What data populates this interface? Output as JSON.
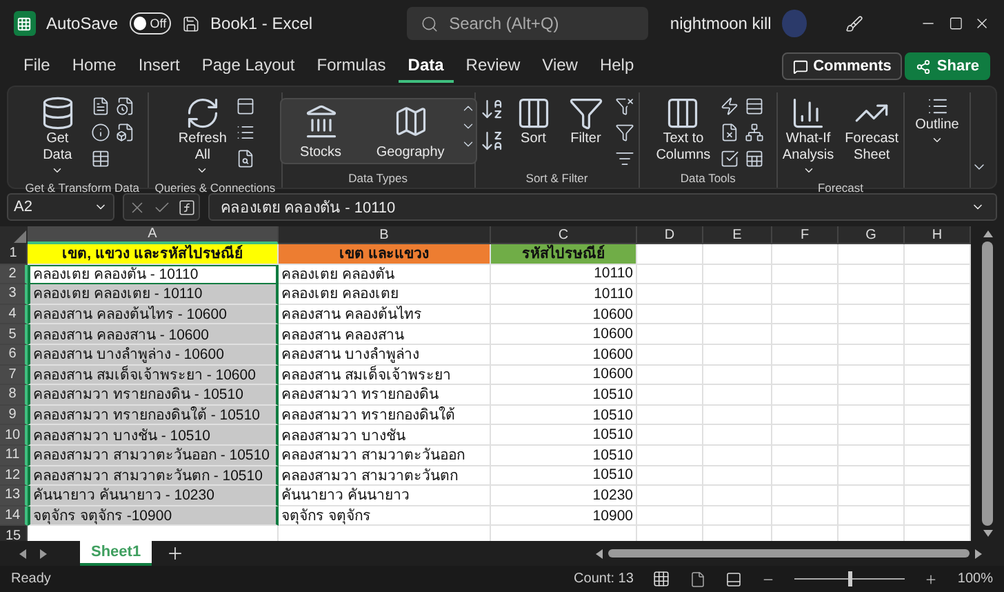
{
  "title_bar": {
    "autosave": {
      "label": "AutoSave",
      "on": false,
      "state_text": "Off"
    },
    "document": "Book1  -  Excel",
    "search": {
      "placeholder": "Search (Alt+Q)"
    },
    "user": "nightmoon kill"
  },
  "menu_tabs": [
    {
      "label": "File",
      "selected": false
    },
    {
      "label": "Home",
      "selected": false
    },
    {
      "label": "Insert",
      "selected": false
    },
    {
      "label": "Page Layout",
      "selected": false
    },
    {
      "label": "Formulas",
      "selected": false
    },
    {
      "label": "Data",
      "selected": true
    },
    {
      "label": "Review",
      "selected": false
    },
    {
      "label": "View",
      "selected": false
    },
    {
      "label": "Help",
      "selected": false
    }
  ],
  "comments_button": "Comments",
  "share_button": "Share",
  "ribbon": {
    "groups": [
      {
        "kind": "buttons",
        "label": "Get & Transform Data",
        "buttons": [
          {
            "label": "Get Data",
            "dropdown": true
          }
        ]
      },
      {
        "kind": "buttons",
        "label": "Queries & Connections",
        "buttons": [
          {
            "label": "Refresh All",
            "dropdown": true
          }
        ]
      },
      {
        "kind": "gallery",
        "label": "Data Types",
        "buttons": [
          {
            "label": "Stocks"
          },
          {
            "label": "Geography"
          }
        ]
      },
      {
        "kind": "buttons",
        "label": "Sort & Filter",
        "buttons": [
          {
            "label": "Sort",
            "dropdown": false
          },
          {
            "label": "Filter",
            "dropdown": false
          }
        ]
      },
      {
        "kind": "buttons",
        "label": "Data Tools",
        "buttons": [
          {
            "label": "Text to Columns",
            "dropdown": false
          }
        ]
      },
      {
        "kind": "buttons",
        "label": "Forecast",
        "buttons": [
          {
            "label": "What-If Analysis",
            "dropdown": true
          },
          {
            "label": "Forecast Sheet",
            "dropdown": false
          }
        ]
      },
      {
        "kind": "buttons",
        "buttons": [
          {
            "label": "Outline",
            "dropdown": true
          }
        ]
      }
    ]
  },
  "formula_bar": {
    "name_box": "A2",
    "formula": "คลองเตย คลองตัน - 10110"
  },
  "sheet": {
    "columns": [
      {
        "label": "A",
        "selected": true
      },
      {
        "label": "B",
        "selected": false
      },
      {
        "label": "C",
        "selected": false
      },
      {
        "label": "D",
        "selected": false
      },
      {
        "label": "E",
        "selected": false
      },
      {
        "label": "F",
        "selected": false
      },
      {
        "label": "G",
        "selected": false
      },
      {
        "label": "H",
        "selected": false
      }
    ],
    "header_row_number": "1",
    "header_row": [
      {
        "text": "เขต, แขวง และรหัสไปรษณีย์",
        "color": "#ffff00"
      },
      {
        "text": "เขต และแขวง",
        "color": "#ed7d31"
      },
      {
        "text": "รหัสไปรษณีย์",
        "color": "#70ad47"
      }
    ],
    "rows": [
      {
        "number": "2",
        "selected": true,
        "active": true,
        "cells": [
          "คลองเตย คลองตัน - 10110",
          "คลองเตย คลองตัน",
          "10110"
        ]
      },
      {
        "number": "3",
        "selected": true,
        "active": false,
        "cells": [
          "คลองเตย คลองเตย - 10110",
          "คลองเตย คลองเตย",
          "10110"
        ]
      },
      {
        "number": "4",
        "selected": true,
        "active": false,
        "cells": [
          "คลองสาน คลองต้นไทร - 10600",
          "คลองสาน คลองต้นไทร",
          "10600"
        ]
      },
      {
        "number": "5",
        "selected": true,
        "active": false,
        "cells": [
          "คลองสาน คลองสาน - 10600",
          "คลองสาน คลองสาน",
          "10600"
        ]
      },
      {
        "number": "6",
        "selected": true,
        "active": false,
        "cells": [
          "คลองสาน บางลำพูล่าง - 10600",
          "คลองสาน บางลำพูล่าง",
          "10600"
        ]
      },
      {
        "number": "7",
        "selected": true,
        "active": false,
        "cells": [
          "คลองสาน สมเด็จเจ้าพระยา - 10600",
          "คลองสาน สมเด็จเจ้าพระยา",
          "10600"
        ]
      },
      {
        "number": "8",
        "selected": true,
        "active": false,
        "cells": [
          "คลองสามวา ทรายกองดิน - 10510",
          "คลองสามวา ทรายกองดิน",
          "10510"
        ]
      },
      {
        "number": "9",
        "selected": true,
        "active": false,
        "cells": [
          "คลองสามวา ทรายกองดินใต้ - 10510",
          "คลองสามวา ทรายกองดินใต้",
          "10510"
        ]
      },
      {
        "number": "10",
        "selected": true,
        "active": false,
        "cells": [
          "คลองสามวา บางชัน - 10510",
          "คลองสามวา บางชัน",
          "10510"
        ]
      },
      {
        "number": "11",
        "selected": true,
        "active": false,
        "cells": [
          "คลองสามวา สามวาตะวันออก - 10510",
          "คลองสามวา สามวาตะวันออก",
          "10510"
        ]
      },
      {
        "number": "12",
        "selected": true,
        "active": false,
        "cells": [
          "คลองสามวา สามวาตะวันตก - 10510",
          "คลองสามวา สามวาตะวันตก",
          "10510"
        ]
      },
      {
        "number": "13",
        "selected": true,
        "active": false,
        "cells": [
          "คันนายาว คันนายาว - 10230",
          "คันนายาว คันนายาว",
          "10230"
        ]
      },
      {
        "number": "14",
        "selected": true,
        "active": false,
        "cells": [
          "จตุจักร จตุจักร -10900",
          "จตุจักร จตุจักร",
          "10900"
        ]
      },
      {
        "number": "15",
        "selected": false,
        "active": false,
        "cells": []
      }
    ]
  },
  "sheet_tabs": [
    {
      "label": "Sheet1",
      "selected": true
    }
  ],
  "status_bar": {
    "status": "Ready",
    "count": "Count: 13",
    "zoom": "100%",
    "zoom_level": {
      "level": 0.5
    }
  }
}
